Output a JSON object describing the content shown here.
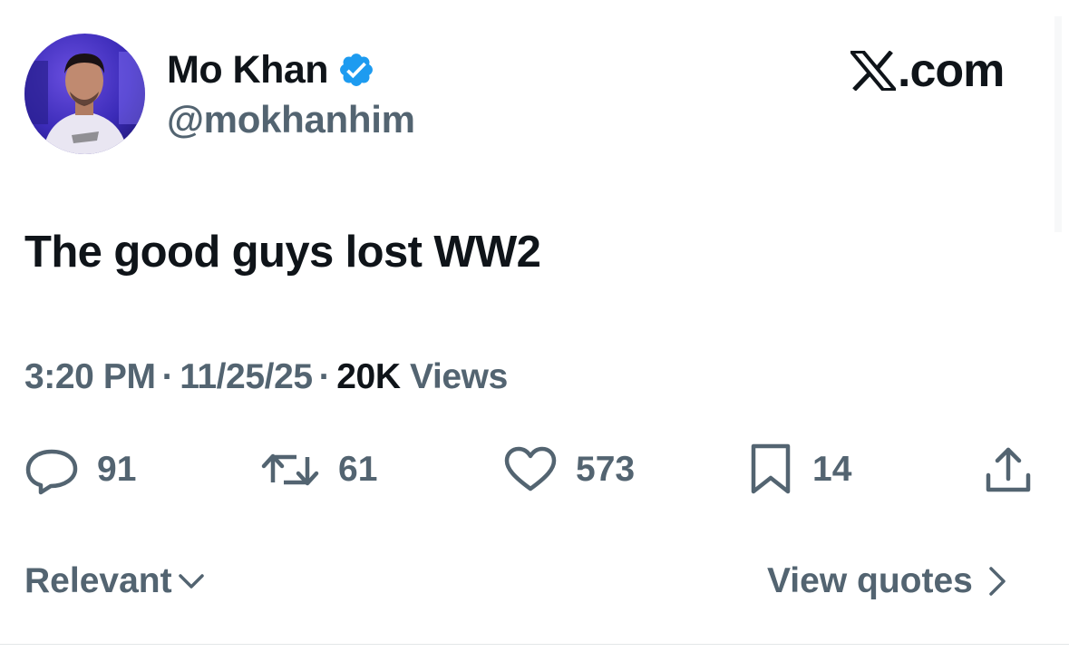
{
  "author": {
    "display_name": "Mo Khan",
    "handle": "@mokhanhim",
    "verified": true,
    "avatar_icon": "profile-photo"
  },
  "brand": {
    "site": ".com",
    "logo_icon": "x-logo-icon"
  },
  "tweet": {
    "text": "The good guys lost WW2"
  },
  "meta": {
    "time": "3:20 PM",
    "separator": "·",
    "date": "11/25/25",
    "views_count": "20K",
    "views_label": "Views"
  },
  "actions": {
    "replies": "91",
    "reposts": "61",
    "likes": "573",
    "bookmarks": "14"
  },
  "footer": {
    "sort_label": "Relevant",
    "quotes_label": "View quotes"
  },
  "colors": {
    "primary_text": "#0f1419",
    "secondary_text": "#536471",
    "verified_blue": "#1d9bf0"
  }
}
